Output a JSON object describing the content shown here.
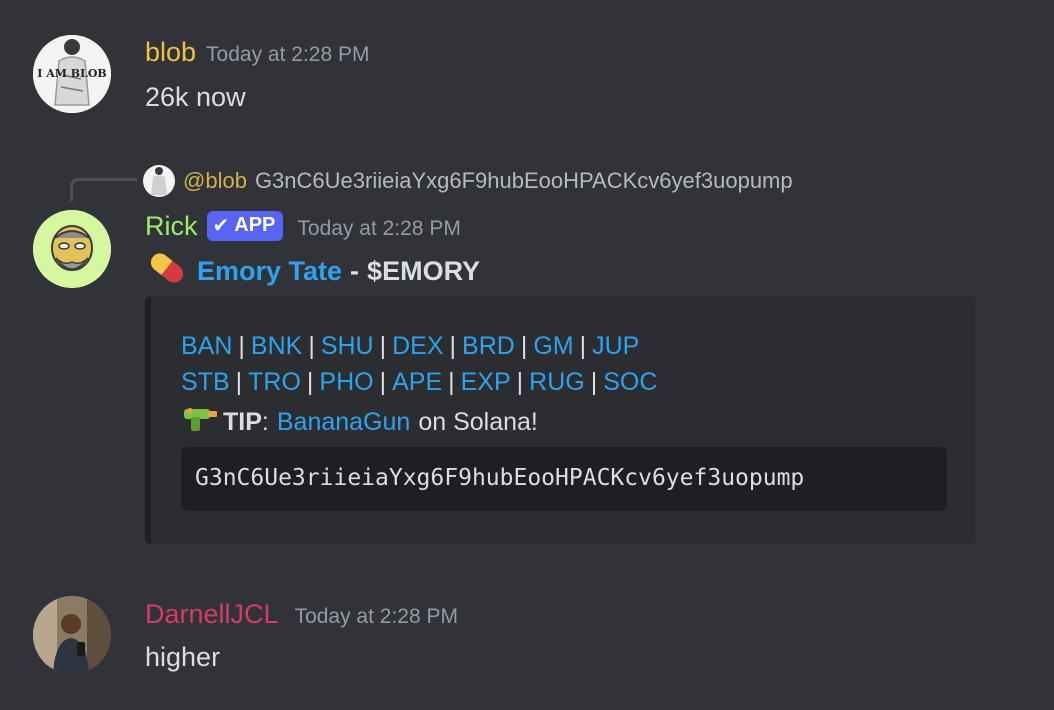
{
  "messages": [
    {
      "username": "blob",
      "username_color": "#f0c045",
      "timestamp": "Today at 2:28 PM",
      "content": "26k now",
      "avatar_text": "I AM BLOB"
    },
    {
      "reply": {
        "mention": "@blob",
        "text": "G3nC6Ue3riieiaYxg6F9hubEooHPACKcv6yef3uopump"
      },
      "username": "Rick",
      "username_color": "#9bee6c",
      "badge": "APP",
      "badge_icon": "checkmark-icon",
      "timestamp": "Today at 2:28 PM",
      "title": {
        "icon": "pill-icon",
        "name": "Emory Tate",
        "separator": "-",
        "ticker": "$EMORY"
      },
      "embed": {
        "row1": [
          "BAN",
          "BNK",
          "SHU",
          "DEX",
          "BRD",
          "GM",
          "JUP"
        ],
        "row2": [
          "STB",
          "TRO",
          "PHO",
          "APE",
          "EXP",
          "RUG",
          "SOC"
        ],
        "pipe": "|",
        "tip_icon": "water-gun-icon",
        "tip_label": "TIP",
        "tip_colon": ":",
        "tip_link": "BananaGun",
        "tip_suffix": "on Solana!",
        "code": "G3nC6Ue3riieiaYxg6F9hubEooHPACKcv6yef3uopump"
      }
    },
    {
      "username": "DarnellJCL",
      "username_color": "#d63a6a",
      "timestamp": "Today at 2:28 PM",
      "content": "higher"
    }
  ]
}
